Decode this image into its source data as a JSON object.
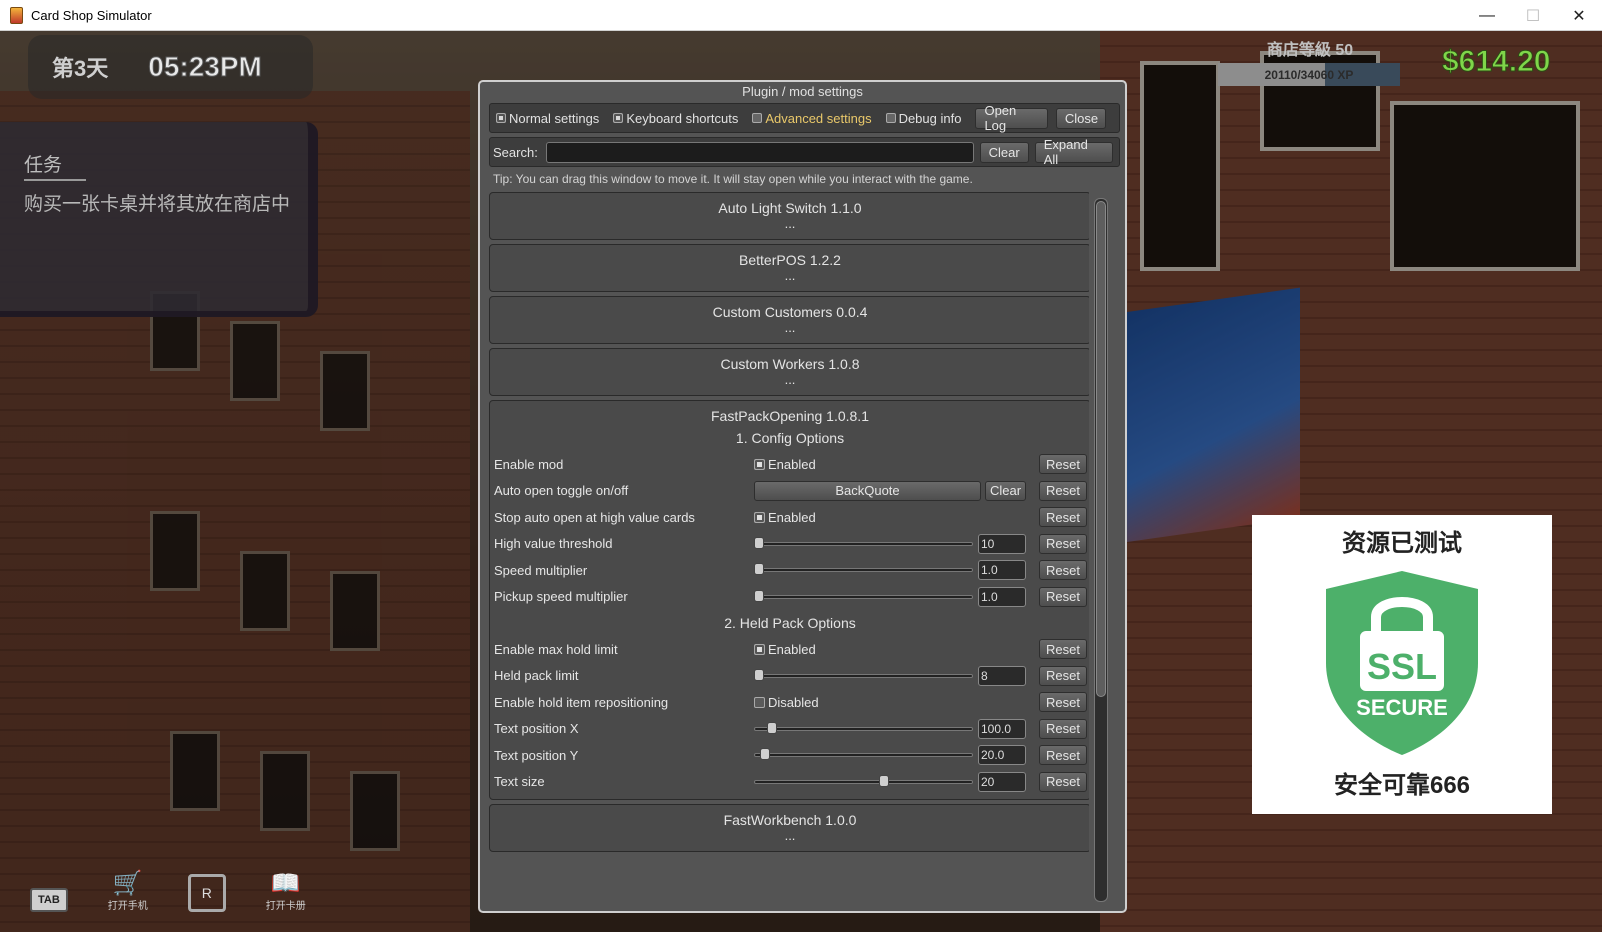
{
  "window": {
    "title": "Card Shop Simulator",
    "minimize": "—",
    "maximize": "☐",
    "close": "✕"
  },
  "hud": {
    "day": "第3天",
    "time": "05:23PM",
    "quest_title": "任务",
    "quest_text": "购买一张卡桌并将其放在商店中",
    "shop_level": "商店等級 50",
    "xp_text": "20110/34060 XP",
    "xp_progress": 0.59,
    "money": "$614.20",
    "money_color": "#7fd64a"
  },
  "hotbar": [
    {
      "key": "TAB",
      "label": ""
    },
    {
      "key": "🛒",
      "label": "打开手机"
    },
    {
      "key": "R",
      "label": ""
    },
    {
      "key": "📖",
      "label": "打开卡册"
    }
  ],
  "ssl_badge": {
    "top_text": "资源已测试",
    "shield_text_1": "SSL",
    "shield_text_2": "SECURE",
    "bottom_text": "安全可靠666",
    "color": "#4db06a"
  },
  "dialog": {
    "title": "Plugin / mod settings",
    "tabs": [
      {
        "label": "Normal settings",
        "checked": true,
        "active": false
      },
      {
        "label": "Keyboard shortcuts",
        "checked": true,
        "active": false
      },
      {
        "label": "Advanced settings",
        "checked": false,
        "active": true
      },
      {
        "label": "Debug info",
        "checked": false,
        "active": false
      }
    ],
    "open_log": "Open Log",
    "close": "Close",
    "search_label": "Search:",
    "search_value": "",
    "clear": "Clear",
    "expand_all": "Expand All",
    "tip": "Tip: You can drag this window to move it. It will stay open while you interact with the game.",
    "collapsed_plugins": [
      {
        "name": "Auto Light Switch 1.1.0",
        "dots": "..."
      },
      {
        "name": "BetterPOS 1.2.2",
        "dots": "..."
      },
      {
        "name": "Custom Customers 0.0.4",
        "dots": "..."
      },
      {
        "name": "Custom Workers 1.0.8",
        "dots": "..."
      }
    ],
    "expanded_plugin": {
      "name": "FastPackOpening 1.0.8.1",
      "section1": "1. Config Options",
      "section2": "2. Held Pack Options",
      "reset": "Reset",
      "clear": "Clear",
      "options": {
        "enable_mod": {
          "label": "Enable mod",
          "state": "Enabled",
          "checked": true
        },
        "auto_open": {
          "label": "Auto open toggle on/off",
          "key": "BackQuote"
        },
        "stop_auto": {
          "label": "Stop auto open at high value cards",
          "state": "Enabled",
          "checked": true
        },
        "high_value": {
          "label": "High value threshold",
          "value": "10",
          "slider": 0.0
        },
        "speed_mult": {
          "label": "Speed multiplier",
          "value": "1.0",
          "slider": 0.0
        },
        "pickup_speed": {
          "label": "Pickup speed multiplier",
          "value": "1.0",
          "slider": 0.0
        },
        "max_hold": {
          "label": "Enable max hold limit",
          "state": "Enabled",
          "checked": true
        },
        "held_limit": {
          "label": "Held pack limit",
          "value": "8",
          "slider": 0.0
        },
        "hold_repos": {
          "label": "Enable hold item repositioning",
          "state": "Disabled",
          "checked": false
        },
        "text_x": {
          "label": "Text position X",
          "value": "100.0",
          "slider": 0.06
        },
        "text_y": {
          "label": "Text position Y",
          "value": "20.0",
          "slider": 0.03
        },
        "text_size": {
          "label": "Text size",
          "value": "20",
          "slider": 0.6
        }
      }
    },
    "after_plugins": [
      {
        "name": "FastWorkbench 1.0.0",
        "dots": "..."
      }
    ]
  }
}
